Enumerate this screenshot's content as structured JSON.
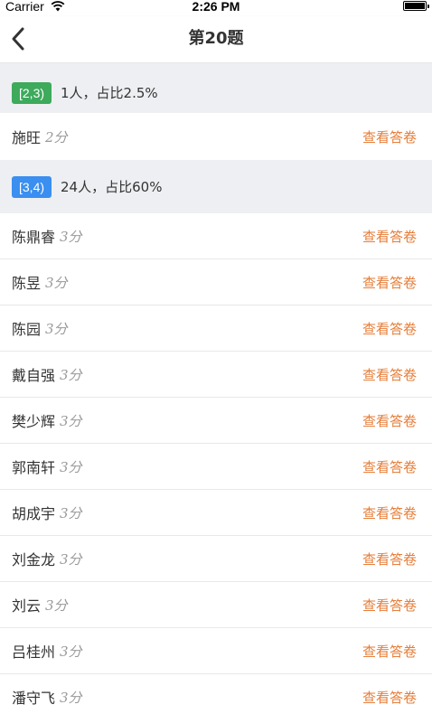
{
  "status_bar": {
    "carrier": "Carrier",
    "time": "2:26 PM"
  },
  "nav": {
    "title": "第20题",
    "back_icon": "chevron-left-icon"
  },
  "colors": {
    "green_tag": "#3daa5c",
    "blue_tag": "#3a8ff0",
    "action": "#e67e3a",
    "section_bg": "#eeeff2"
  },
  "groups": [
    {
      "range": "[2,3)",
      "summary": "1人，占比2.5%",
      "students": [
        {
          "name": "施旺",
          "score": "2分",
          "action": "查看答卷"
        }
      ]
    },
    {
      "range": "[3,4)",
      "summary": "24人，占比60%",
      "students": [
        {
          "name": "陈鼎睿",
          "score": "3分",
          "action": "查看答卷"
        },
        {
          "name": "陈昱",
          "score": "3分",
          "action": "查看答卷"
        },
        {
          "name": "陈园",
          "score": "3分",
          "action": "查看答卷"
        },
        {
          "name": "戴自强",
          "score": "3分",
          "action": "查看答卷"
        },
        {
          "name": "樊少辉",
          "score": "3分",
          "action": "查看答卷"
        },
        {
          "name": "郭南轩",
          "score": "3分",
          "action": "查看答卷"
        },
        {
          "name": "胡成宇",
          "score": "3分",
          "action": "查看答卷"
        },
        {
          "name": "刘金龙",
          "score": "3分",
          "action": "查看答卷"
        },
        {
          "name": "刘云",
          "score": "3分",
          "action": "查看答卷"
        },
        {
          "name": "吕桂州",
          "score": "3分",
          "action": "查看答卷"
        },
        {
          "name": "潘守飞",
          "score": "3分",
          "action": "查看答卷"
        }
      ]
    }
  ]
}
